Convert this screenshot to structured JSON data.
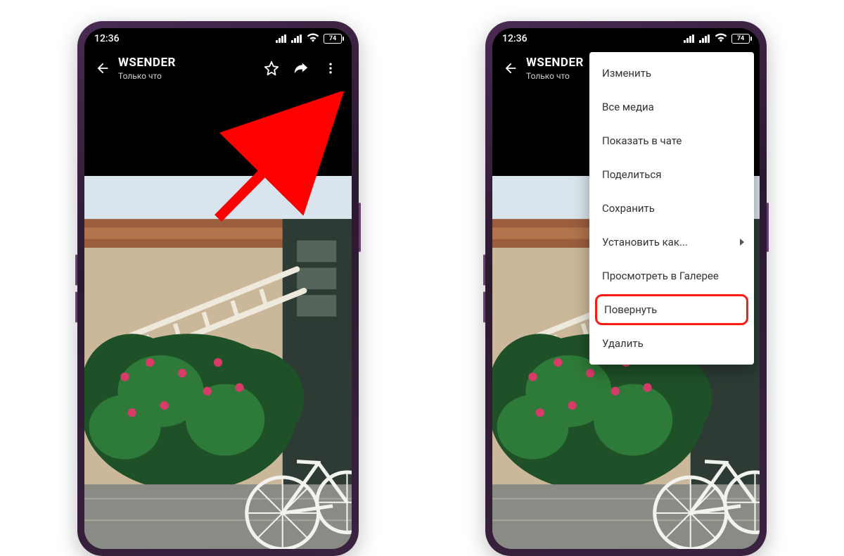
{
  "statusbar": {
    "time": "12:36",
    "battery": "74"
  },
  "header": {
    "title": "WSENDER",
    "subtitle": "Только что"
  },
  "menu": {
    "items": [
      {
        "label": "Изменить",
        "submenu": false,
        "highlight": false
      },
      {
        "label": "Все медиа",
        "submenu": false,
        "highlight": false
      },
      {
        "label": "Показать в чате",
        "submenu": false,
        "highlight": false
      },
      {
        "label": "Поделиться",
        "submenu": false,
        "highlight": false
      },
      {
        "label": "Сохранить",
        "submenu": false,
        "highlight": false
      },
      {
        "label": "Установить как...",
        "submenu": true,
        "highlight": false
      },
      {
        "label": "Просмотреть в Галерее",
        "submenu": false,
        "highlight": false
      },
      {
        "label": "Повернуть",
        "submenu": false,
        "highlight": true
      },
      {
        "label": "Удалить",
        "submenu": false,
        "highlight": false
      }
    ]
  }
}
